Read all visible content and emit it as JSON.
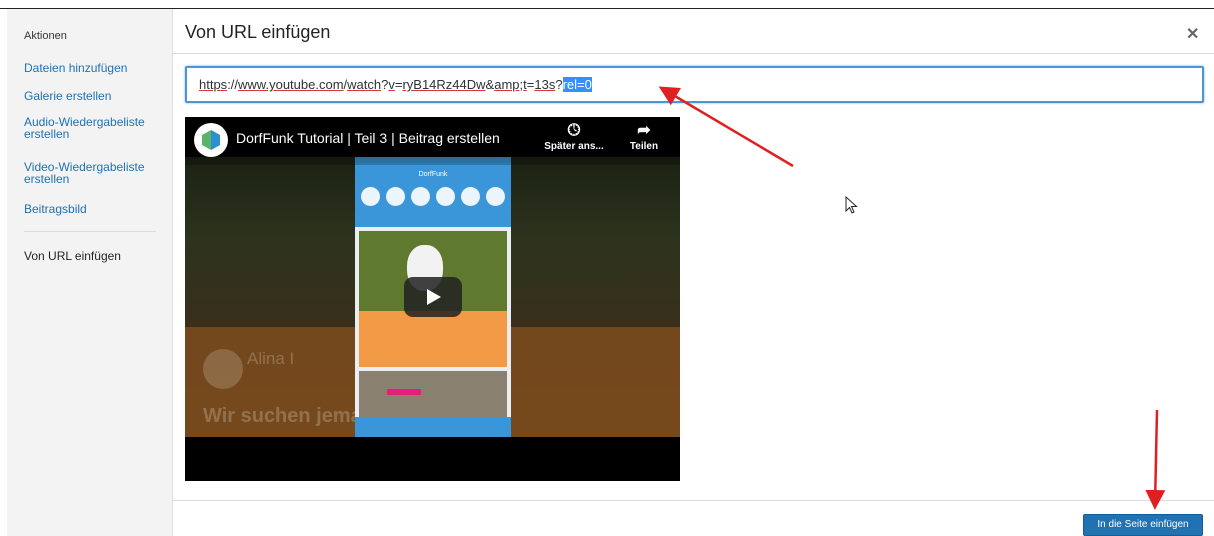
{
  "sidebar": {
    "heading": "Aktionen",
    "items": [
      {
        "label": "Dateien hinzufügen"
      },
      {
        "label": "Galerie erstellen"
      },
      {
        "label": "Audio-Wiedergabeliste erstellen"
      },
      {
        "label": "Video-Wiedergabeliste erstellen"
      },
      {
        "label": "Beitragsbild"
      }
    ],
    "active_item": "Von URL einfügen"
  },
  "modal": {
    "title": "Von URL einfügen",
    "close_icon": "close-icon",
    "url_field": {
      "value_parts": {
        "p1": "https",
        "p2": "://",
        "p3": "www.youtube.com",
        "p4": "/",
        "p5": "watch",
        "p6": "?",
        "p7": "v",
        "p8": "=",
        "p9": "ryB14Rz44Dw",
        "p10": "&",
        "p11": "amp",
        "p12": ";",
        "p13": "t",
        "p14": "=",
        "p15": "13s",
        "p16": "?",
        "selected": "rel=0"
      }
    },
    "video": {
      "title": "DorfFunk Tutorial | Teil 3 | Beitrag erstellen",
      "watch_later_label": "Später ans...",
      "share_label": "Teilen",
      "play_icon": "play-icon",
      "ghost_name": "Alina I",
      "ghost_text": "Wir suchen jema            e Hündin Mina",
      "phone_title": "DorfFunk"
    },
    "insert_button": "In die Seite einfügen"
  },
  "colors": {
    "accent": "#2271b1",
    "focus_border": "#4f94d4",
    "selection": "#3390ff",
    "annotation_arrow": "#e02020"
  }
}
